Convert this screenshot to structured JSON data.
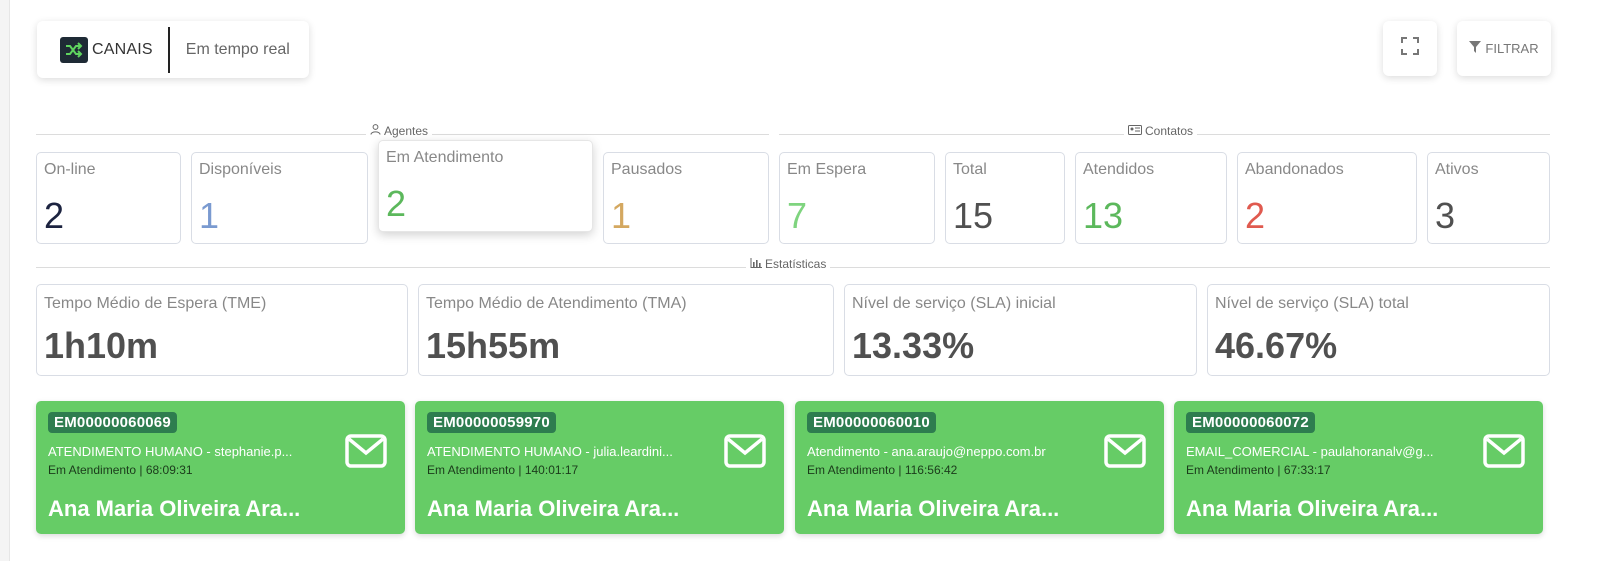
{
  "header": {
    "channel_label": "CANAIS",
    "mode_label": "Em tempo real",
    "filter_label": "FILTRAR",
    "icons": [
      "shuffle-icon",
      "fullscreen-icon",
      "filter-icon"
    ]
  },
  "sections": {
    "agents": "Agentes",
    "contacts": "Contatos",
    "statistics": "Estatísticas"
  },
  "agents": [
    {
      "label": "On-line",
      "value": "2",
      "color": "#1c2340"
    },
    {
      "label": "Disponíveis",
      "value": "1",
      "color": "#7a9ad0"
    },
    {
      "label": "Em Atendimento",
      "value": "2",
      "color": "#5cb85c"
    },
    {
      "label": "Pausados",
      "value": "1",
      "color": "#d4a860"
    }
  ],
  "contacts": [
    {
      "label": "Em Espera",
      "value": "7",
      "color": "#7fd47f"
    },
    {
      "label": "Total",
      "value": "15",
      "color": "#505050"
    },
    {
      "label": "Atendidos",
      "value": "13",
      "color": "#5cb85c"
    },
    {
      "label": "Abandonados",
      "value": "2",
      "color": "#e05a4f"
    },
    {
      "label": "Ativos",
      "value": "3",
      "color": "#505050"
    }
  ],
  "statistics": [
    {
      "label": "Tempo Médio de Espera (TME)",
      "value": "1h10m"
    },
    {
      "label": "Tempo Médio de Atendimento (TMA)",
      "value": "15h55m"
    },
    {
      "label": "Nível de serviço (SLA) inicial",
      "value": "13.33%"
    },
    {
      "label": "Nível de serviço (SLA) total",
      "value": "46.67%"
    }
  ],
  "tickets": [
    {
      "id": "EM00000060069",
      "info": "ATENDIMENTO HUMANO - stephanie.p...",
      "status": "Em Atendimento | 68:09:31",
      "name": "Ana Maria Oliveira Ara..."
    },
    {
      "id": "EM00000059970",
      "info": "ATENDIMENTO HUMANO - julia.leardini...",
      "status": "Em Atendimento | 140:01:17",
      "name": "Ana Maria Oliveira Ara..."
    },
    {
      "id": "EM00000060010",
      "info": "Atendimento - ana.araujo@neppo.com.br",
      "status": "Em Atendimento | 116:56:42",
      "name": "Ana Maria Oliveira Ara..."
    },
    {
      "id": "EM00000060072",
      "info": "EMAIL_COMERCIAL - paulahoranalv@g...",
      "status": "Em Atendimento | 67:33:17",
      "name": "Ana Maria Oliveira Ara..."
    }
  ],
  "colors": {
    "ticket_bg": "#66cc66",
    "ticket_id_bg": "#2e7d4f"
  }
}
